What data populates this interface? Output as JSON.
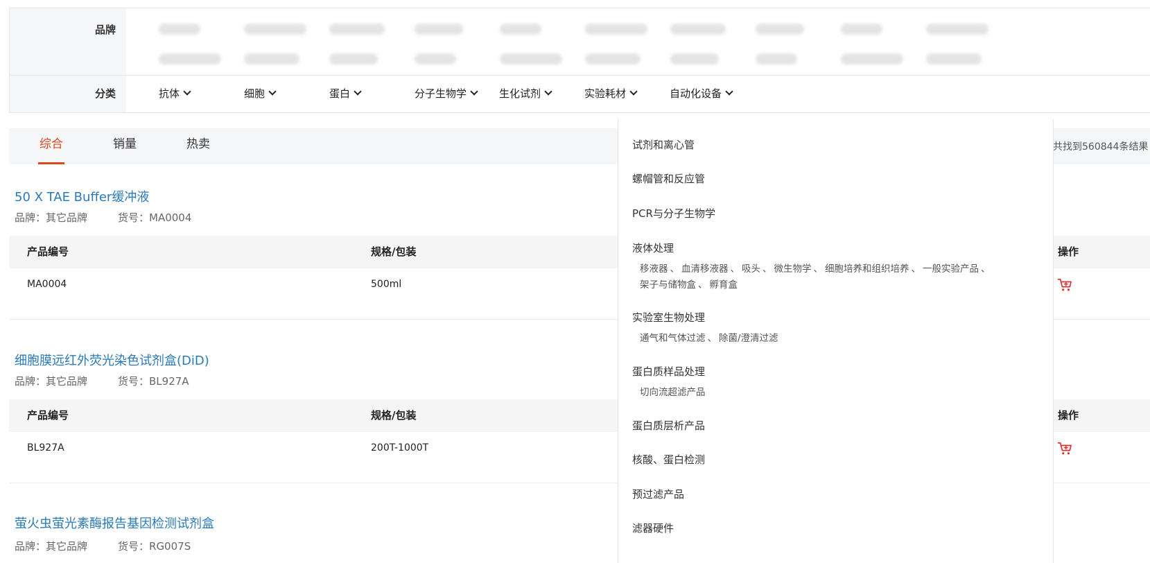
{
  "filter": {
    "brand_label": "品牌",
    "category_label": "分类",
    "categories": [
      "抗体",
      "细胞",
      "蛋白",
      "分子生物学",
      "生化试剂",
      "实验耗材",
      "自动化设备"
    ]
  },
  "sort": {
    "tabs": [
      "综合",
      "销量",
      "热卖"
    ],
    "result_count": "共找到560844条结果"
  },
  "table_headers": {
    "code": "产品编号",
    "spec": "规格/包装",
    "action": "操作"
  },
  "products": [
    {
      "title": "50 X TAE Buffer缓冲液",
      "brand": "品牌：其它品牌",
      "sku": "货号：MA0004",
      "code": "MA0004",
      "spec": "500ml"
    },
    {
      "title": "细胞膜远红外荧光染色试剂盒(DiD)",
      "brand": "品牌：其它品牌",
      "sku": "货号：BL927A",
      "code": "BL927A",
      "spec": "200T-1000T"
    },
    {
      "title": "萤火虫萤光素酶报告基因检测试剂盒",
      "brand": "品牌：其它品牌",
      "sku": "货号：RG007S"
    }
  ],
  "dropdown": {
    "items": [
      {
        "label": "试剂和离心管"
      },
      {
        "label": "螺帽管和反应管"
      },
      {
        "label": "PCR与分子生物学"
      },
      {
        "label": "液体处理",
        "subs": [
          "移液器",
          "血清移液器",
          "吸头",
          "微生物学",
          "细胞培养和组织培养",
          "一般实验产品",
          "架子与储物盒",
          "孵育盒"
        ]
      },
      {
        "label": "实验室生物处理",
        "subs": [
          "通气和气体过滤",
          "除菌/澄清过滤"
        ]
      },
      {
        "label": "蛋白质样品处理",
        "subs": [
          "切向流超滤产品"
        ]
      },
      {
        "label": "蛋白质层析产品"
      },
      {
        "label": "核酸、蛋白检测"
      },
      {
        "label": "预过滤产品"
      },
      {
        "label": "滤器硬件"
      }
    ]
  },
  "colors": {
    "accent": "#e0471e",
    "link": "#2a7ab8",
    "cart": "#e02a2a"
  }
}
